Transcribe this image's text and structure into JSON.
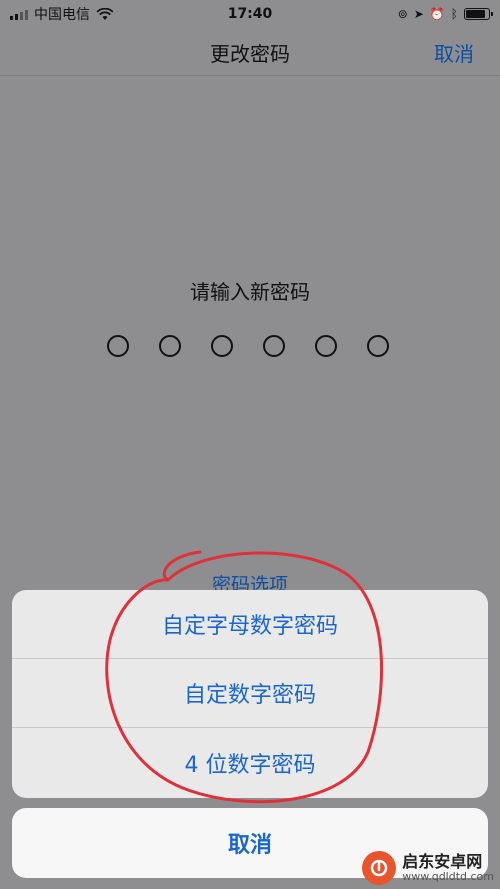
{
  "status_bar": {
    "carrier": "中国电信",
    "time": "17:40"
  },
  "nav": {
    "title": "更改密码",
    "cancel_label": "取消"
  },
  "passcode": {
    "prompt": "请输入新密码",
    "digits_total": 6,
    "digits_entered": 0
  },
  "options_link": "密码选项",
  "action_sheet": {
    "items": [
      {
        "label": "自定字母数字密码"
      },
      {
        "label": "自定数字密码"
      },
      {
        "label": "4 位数字密码"
      }
    ],
    "cancel_label": "取消"
  },
  "watermark": {
    "title": "启东安卓网",
    "url": "www.qdldtd.com"
  },
  "colors": {
    "accent": "#1a66cf",
    "annotation": "#e0303a",
    "overlay_bg": "#8e8e90"
  }
}
